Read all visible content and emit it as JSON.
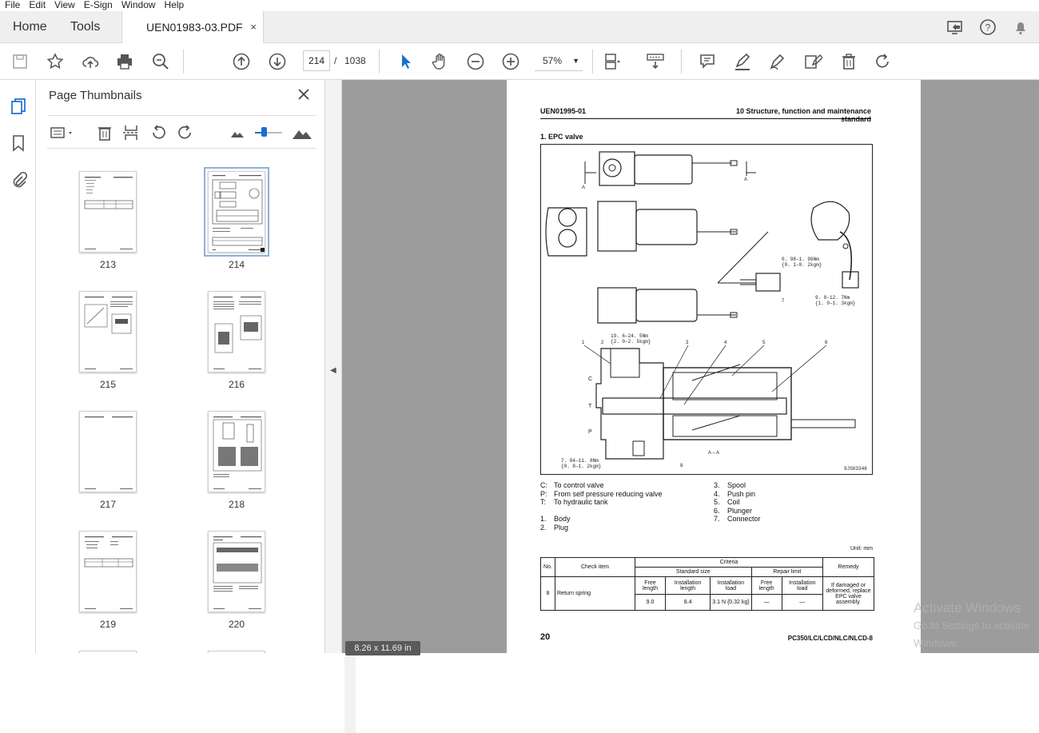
{
  "menu": [
    "File",
    "Edit",
    "View",
    "E-Sign",
    "Window",
    "Help"
  ],
  "tabs": {
    "home": "Home",
    "tools": "Tools",
    "document": "UEN01983-03.PDF",
    "close": "×"
  },
  "toolbar": {
    "current_page": "214",
    "page_sep": "/",
    "total_pages": "1038",
    "zoom": "57%"
  },
  "panel": {
    "title": "Page Thumbnails",
    "thumbnails": [
      {
        "label": "213"
      },
      {
        "label": "214"
      },
      {
        "label": "215"
      },
      {
        "label": "216"
      },
      {
        "label": "217"
      },
      {
        "label": "218"
      },
      {
        "label": "219"
      },
      {
        "label": "220"
      }
    ]
  },
  "viewer": {
    "page_size": "8.26 x 11.69 in"
  },
  "document": {
    "header_left": "UEN01995-01",
    "header_right": "10 Structure, function and maintenance standard",
    "section_title": "1. EPC valve",
    "figure_code": "9JS03346",
    "section_label": "A – A",
    "torque_1": "19. 6–24. 5Nm",
    "torque_1b": "{2. 0–2. 5kgm}",
    "torque_2": "0. 98–1. 96Nm",
    "torque_2b": "{0. 1–0. 2kgm}",
    "torque_3": "9. 8–12. 7Nm",
    "torque_3b": "{1. 0–1. 3kgm}",
    "torque_4": "7. 84–11. 8Nm",
    "torque_4b": "{0. 8–1. 2kgm}",
    "legend_left": [
      {
        "key": "C:",
        "text": "To control valve"
      },
      {
        "key": "P:",
        "text": "From self pressure reducing valve"
      },
      {
        "key": "T:",
        "text": "To hydraulic tank"
      },
      {
        "key": "",
        "text": ""
      },
      {
        "key": "1.",
        "text": "Body"
      },
      {
        "key": "2.",
        "text": "Plug"
      }
    ],
    "legend_right": [
      {
        "key": "3.",
        "text": "Spool"
      },
      {
        "key": "4.",
        "text": "Push pin"
      },
      {
        "key": "5.",
        "text": "Coil"
      },
      {
        "key": "6.",
        "text": "Plunger"
      },
      {
        "key": "7.",
        "text": "Connector"
      }
    ],
    "unit": "Unit: mm",
    "table": {
      "no": "No.",
      "check_item": "Check item",
      "criteria": "Criteria",
      "remedy": "Remedy",
      "standard_size": "Standard size",
      "repair_limit": "Repair limit",
      "free_length": "Free length",
      "installation_length": "Installation length",
      "installation_load": "Installation load",
      "row_no": "8",
      "row_item": "Return spring",
      "std_free": "9.0",
      "std_inst_len": "8.4",
      "std_inst_load": "3.1 N {0.32 kg}",
      "rep_free": "—",
      "rep_load": "—",
      "remedy_text": "If damaged or deformed, replace EPC valve assembly."
    },
    "page_number": "20",
    "model": "PC350/LC/LCD/NLC/NLCD-8"
  },
  "watermark": {
    "line1": "Activate Windows",
    "line2": "Go to Settings to activate Windows."
  }
}
